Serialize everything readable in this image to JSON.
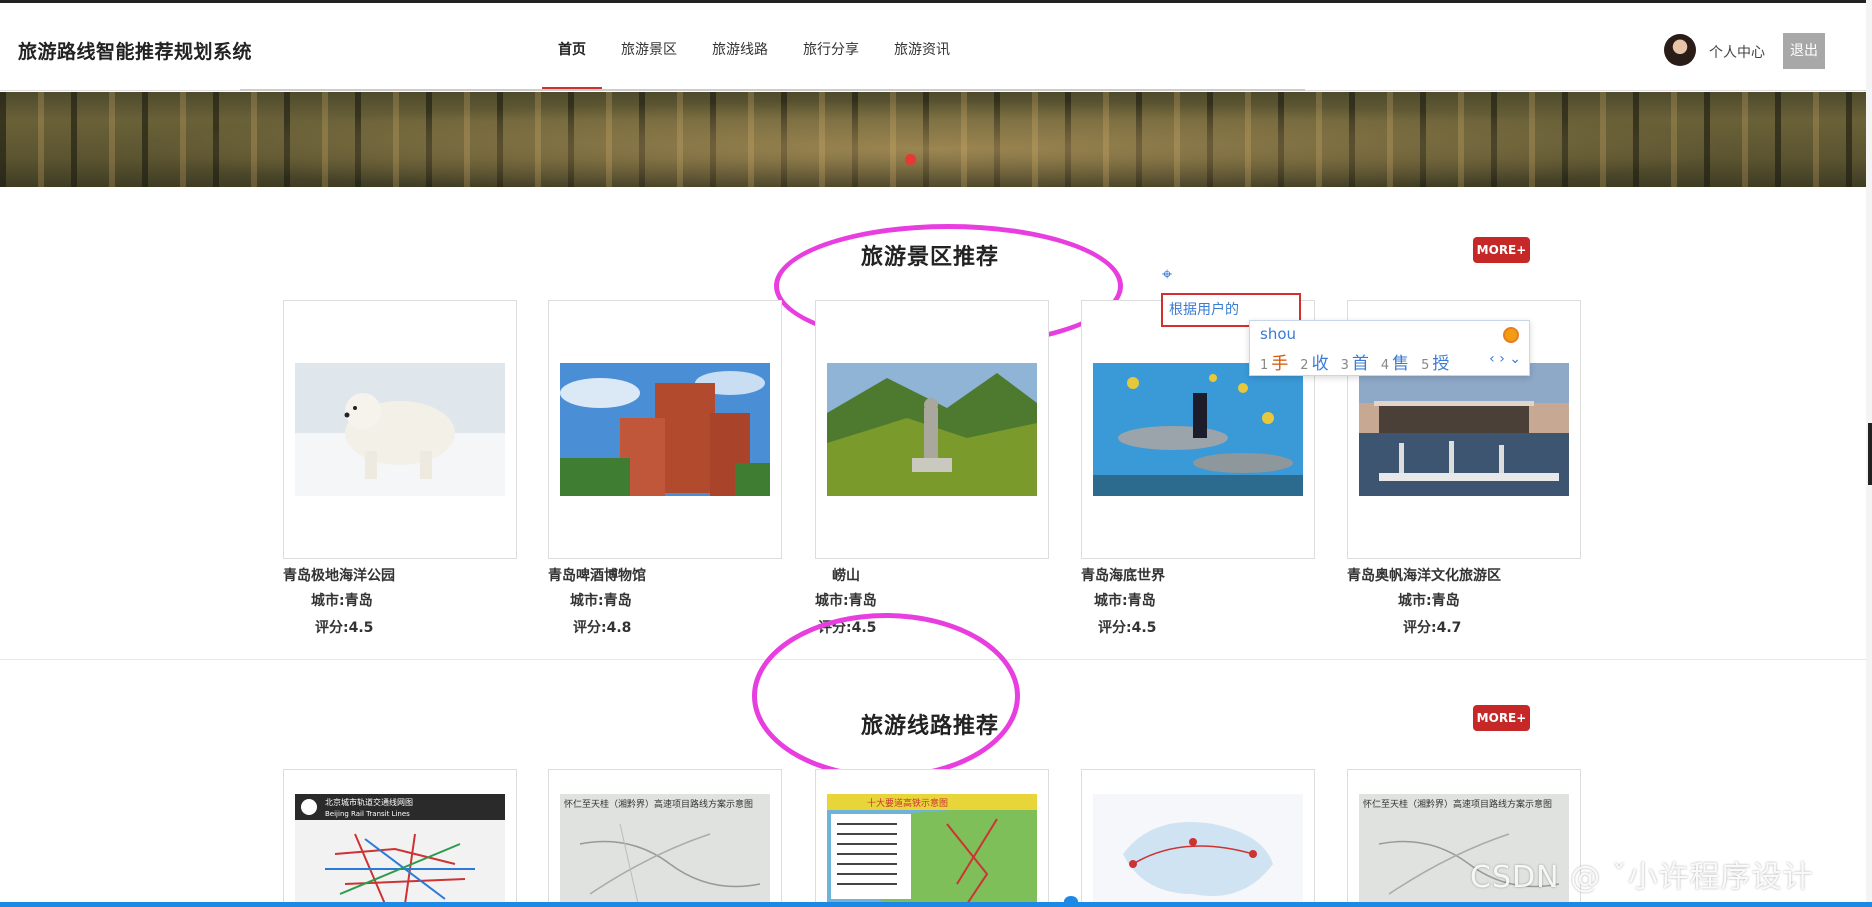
{
  "header": {
    "brand": "旅游路线智能推荐规划系统",
    "nav": [
      "首页",
      "旅游景区",
      "旅游线路",
      "旅行分享",
      "旅游资讯"
    ],
    "active_nav": "首页",
    "user_center": "个人中心",
    "logout": "退出"
  },
  "scenic": {
    "title": "旅游景区推荐",
    "more": "MORE+",
    "items": [
      {
        "name": "青岛极地海洋公园",
        "city": "城市:青岛",
        "rating": "评分:4.5"
      },
      {
        "name": "青岛啤酒博物馆",
        "city": "城市:青岛",
        "rating": "评分:4.8"
      },
      {
        "name": "崂山",
        "city": "城市:青岛",
        "rating": "评分:4.5"
      },
      {
        "name": "青岛海底世界",
        "city": "城市:青岛",
        "rating": "评分:4.5"
      },
      {
        "name": "青岛奥帆海洋文化旅游区",
        "city": "城市:青岛",
        "rating": "评分:4.7"
      }
    ]
  },
  "routes": {
    "title": "旅游线路推荐",
    "more": "MORE+",
    "map_labels": [
      "北京城市轨道交通线网图",
      "Beijing Rail Transit Lines",
      "怀仁至天桂（湘黔界）高速项目路线方案示意图",
      "十大要道高铁示意图"
    ]
  },
  "ime": {
    "input_text": "根据用户的",
    "pinyin": "shou",
    "candidates": [
      {
        "n": "1",
        "c": "手"
      },
      {
        "n": "2",
        "c": "收"
      },
      {
        "n": "3",
        "c": "首"
      },
      {
        "n": "4",
        "c": "售"
      },
      {
        "n": "5",
        "c": "授"
      }
    ]
  },
  "watermark": "CSDN @ ˇ小许程序设计",
  "colors": {
    "accent": "#d32f2f",
    "more": "#c62828",
    "annotation": "#e83ee0",
    "ime": "#3a7bd5"
  }
}
